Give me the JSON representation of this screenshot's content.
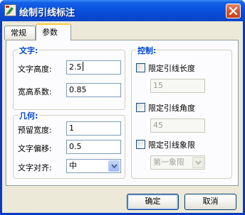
{
  "window": {
    "title": "绘制引线标注",
    "close_icon": "close-icon",
    "app_icon": "app-icon"
  },
  "tabs": [
    {
      "label": "常规",
      "active": false
    },
    {
      "label": "参数",
      "active": true
    }
  ],
  "text_group": {
    "title": "文字:",
    "height_label": "文字高度:",
    "height_value": "2.5",
    "aspect_label": "宽高系数:",
    "aspect_value": "0.85"
  },
  "geometry_group": {
    "title": "几何:",
    "reserve_width_label": "预留宽度:",
    "reserve_width_value": "1",
    "text_offset_label": "文字偏移:",
    "text_offset_value": "0.5",
    "text_align_label": "文字对齐:",
    "text_align_value": "中"
  },
  "control_group": {
    "title": "控制:",
    "limit_length_label": "限定引线长度",
    "limit_length_checked": false,
    "limit_length_value": "15",
    "limit_angle_label": "限定引线角度",
    "limit_angle_checked": false,
    "limit_angle_value": "45",
    "limit_quadrant_label": "限定引线象限",
    "limit_quadrant_checked": false,
    "limit_quadrant_value": "第一象限"
  },
  "buttons": {
    "ok": "确定",
    "cancel": "取消"
  },
  "colors": {
    "titlebar": "#0a52de",
    "group_title": "#0046d5",
    "face": "#ece9d8"
  }
}
